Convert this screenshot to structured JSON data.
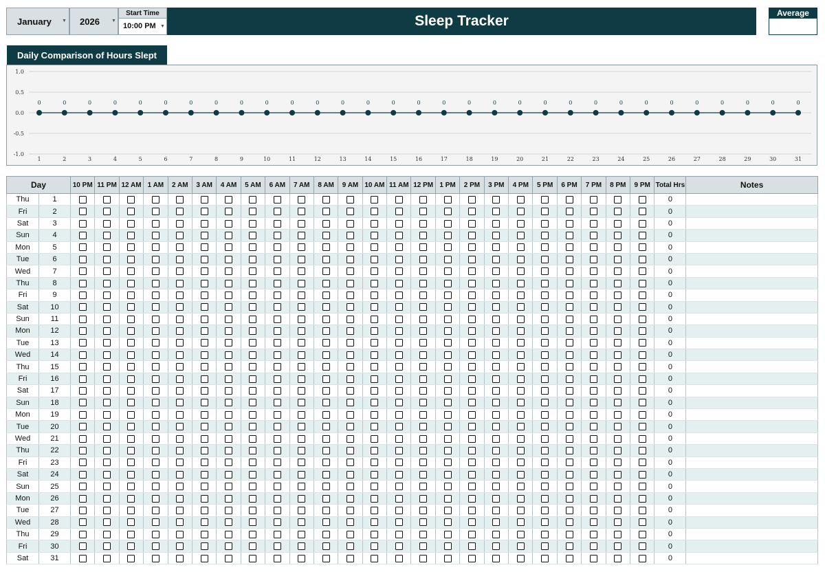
{
  "header": {
    "month": "January",
    "year": "2026",
    "start_time_label": "Start Time",
    "start_time": "10:00 PM",
    "title": "Sleep Tracker",
    "average_label": "Average",
    "average_value": ""
  },
  "chart_data": {
    "type": "line",
    "title": "Daily Comparison of Hours Slept",
    "x": [
      1,
      2,
      3,
      4,
      5,
      6,
      7,
      8,
      9,
      10,
      11,
      12,
      13,
      14,
      15,
      16,
      17,
      18,
      19,
      20,
      21,
      22,
      23,
      24,
      25,
      26,
      27,
      28,
      29,
      30,
      31
    ],
    "series": [
      {
        "values": [
          0,
          0,
          0,
          0,
          0,
          0,
          0,
          0,
          0,
          0,
          0,
          0,
          0,
          0,
          0,
          0,
          0,
          0,
          0,
          0,
          0,
          0,
          0,
          0,
          0,
          0,
          0,
          0,
          0,
          0,
          0
        ]
      }
    ],
    "ylim": [
      -1.0,
      1.0
    ],
    "y_ticks": [
      "1.0",
      "0.5",
      "0.0",
      "-0.5",
      "-1.0"
    ],
    "grid": true,
    "data_labels": true,
    "colors": {
      "line": "#0f3b44"
    }
  },
  "table": {
    "day_header": "Day",
    "hour_headers": [
      "10 PM",
      "11 PM",
      "12 AM",
      "1 AM",
      "2 AM",
      "3 AM",
      "4 AM",
      "5 AM",
      "6 AM",
      "7 AM",
      "8 AM",
      "9 AM",
      "10 AM",
      "11 AM",
      "12 PM",
      "1 PM",
      "2 PM",
      "3 PM",
      "4 PM",
      "5 PM",
      "6 PM",
      "7 PM",
      "8 PM",
      "9 PM"
    ],
    "total_header": "Total Hrs",
    "notes_header": "Notes",
    "rows": [
      {
        "dow": "Thu",
        "day": "1",
        "total": "0"
      },
      {
        "dow": "Fri",
        "day": "2",
        "total": "0"
      },
      {
        "dow": "Sat",
        "day": "3",
        "total": "0"
      },
      {
        "dow": "Sun",
        "day": "4",
        "total": "0"
      },
      {
        "dow": "Mon",
        "day": "5",
        "total": "0"
      },
      {
        "dow": "Tue",
        "day": "6",
        "total": "0"
      },
      {
        "dow": "Wed",
        "day": "7",
        "total": "0"
      },
      {
        "dow": "Thu",
        "day": "8",
        "total": "0"
      },
      {
        "dow": "Fri",
        "day": "9",
        "total": "0"
      },
      {
        "dow": "Sat",
        "day": "10",
        "total": "0"
      },
      {
        "dow": "Sun",
        "day": "11",
        "total": "0"
      },
      {
        "dow": "Mon",
        "day": "12",
        "total": "0"
      },
      {
        "dow": "Tue",
        "day": "13",
        "total": "0"
      },
      {
        "dow": "Wed",
        "day": "14",
        "total": "0"
      },
      {
        "dow": "Thu",
        "day": "15",
        "total": "0"
      },
      {
        "dow": "Fri",
        "day": "16",
        "total": "0"
      },
      {
        "dow": "Sat",
        "day": "17",
        "total": "0"
      },
      {
        "dow": "Sun",
        "day": "18",
        "total": "0"
      },
      {
        "dow": "Mon",
        "day": "19",
        "total": "0"
      },
      {
        "dow": "Tue",
        "day": "20",
        "total": "0"
      },
      {
        "dow": "Wed",
        "day": "21",
        "total": "0"
      },
      {
        "dow": "Thu",
        "day": "22",
        "total": "0"
      },
      {
        "dow": "Fri",
        "day": "23",
        "total": "0"
      },
      {
        "dow": "Sat",
        "day": "24",
        "total": "0"
      },
      {
        "dow": "Sun",
        "day": "25",
        "total": "0"
      },
      {
        "dow": "Mon",
        "day": "26",
        "total": "0"
      },
      {
        "dow": "Tue",
        "day": "27",
        "total": "0"
      },
      {
        "dow": "Wed",
        "day": "28",
        "total": "0"
      },
      {
        "dow": "Thu",
        "day": "29",
        "total": "0"
      },
      {
        "dow": "Fri",
        "day": "30",
        "total": "0"
      },
      {
        "dow": "Sat",
        "day": "31",
        "total": "0"
      }
    ]
  }
}
